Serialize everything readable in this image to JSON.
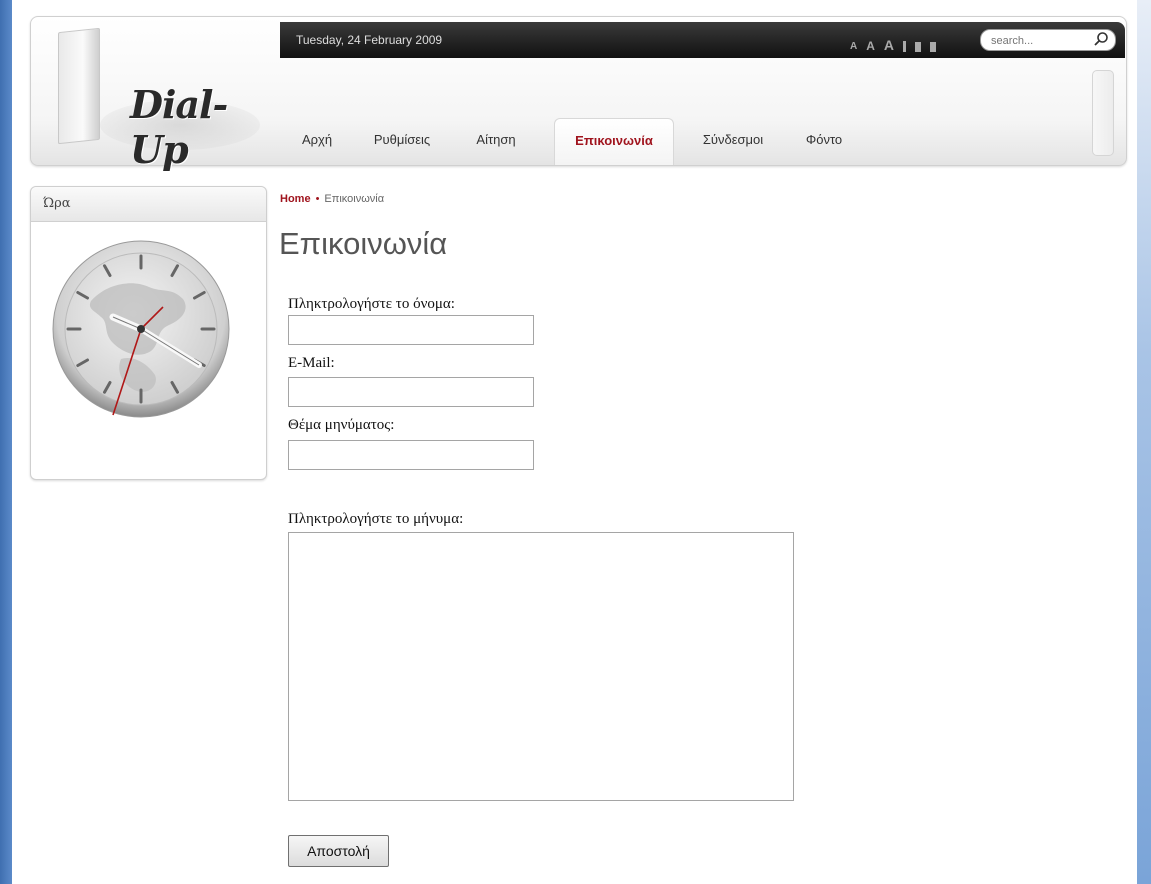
{
  "colors": {
    "accent": "#a0141e",
    "topbar": "#1a1a1a",
    "frame": "#4a7cc0"
  },
  "site": {
    "logo_text": "Dial-Up"
  },
  "topbar": {
    "date": "Tuesday, 24 February 2009",
    "search_placeholder": "search...",
    "font_tools": [
      "A",
      "A",
      "A"
    ]
  },
  "nav": {
    "items": [
      {
        "label": "Αρχή"
      },
      {
        "label": "Ρυθμίσεις"
      },
      {
        "label": "Αίτηση"
      },
      {
        "label": "Επικοινωνία",
        "active": true
      },
      {
        "label": "Σύνδεσμοι"
      },
      {
        "label": "Φόντο"
      }
    ]
  },
  "sidebar": {
    "module_title": "Ώρα"
  },
  "breadcrumb": {
    "home": "Home",
    "separator": "•",
    "current": "Επικοινωνία"
  },
  "content": {
    "title": "Επικοινωνία",
    "form": {
      "name_label": "Πληκτρολογήστε το όνομα:",
      "name_value": "",
      "email_label": "E-Mail:",
      "email_value": "",
      "subject_label": "Θέμα μηνύματος:",
      "subject_value": "",
      "message_label": "Πληκτρολογήστε το μήνυμα:",
      "message_value": "",
      "submit_label": "Αποστολή"
    }
  }
}
